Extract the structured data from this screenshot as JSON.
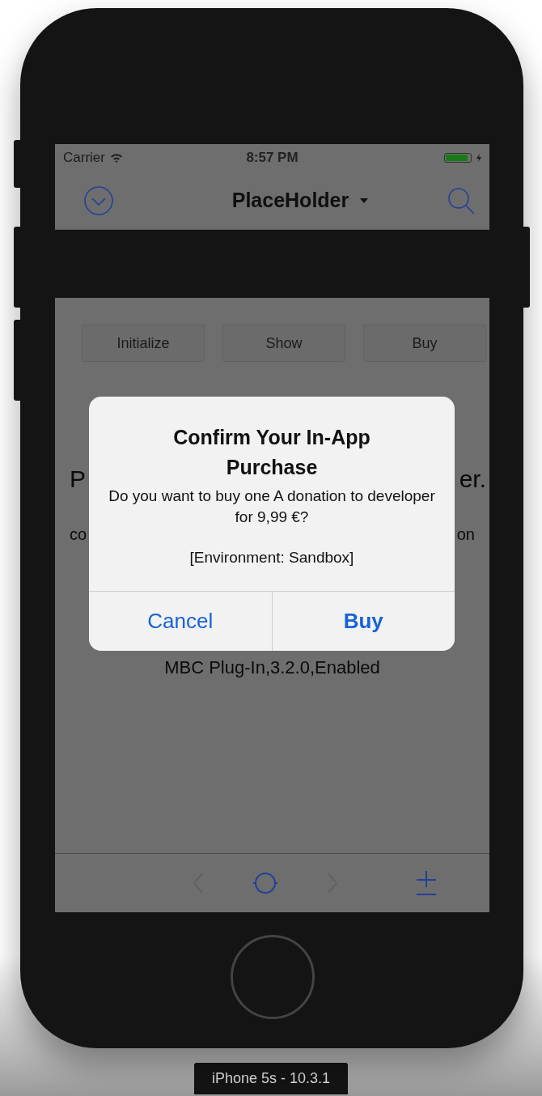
{
  "status_bar": {
    "carrier": "Carrier",
    "time": "8:57 PM",
    "charging": true,
    "level": 0.9
  },
  "nav_bar": {
    "title": "PlaceHolder"
  },
  "buttons": [
    {
      "label": "Initialize"
    },
    {
      "label": "Show"
    },
    {
      "label": "Buy"
    }
  ],
  "background_text": [
    {
      "left": "P",
      "right": "er."
    },
    {
      "left": "co",
      "right": "on"
    }
  ],
  "partly_hidden_line": "MBC Plug-In,3.2.0,Enabled",
  "alert": {
    "title": "Confirm Your In-App Purchase",
    "message": "Do you want to buy one A donation to developer for 9,99 €?",
    "environment": "[Environment: Sandbox]",
    "actions": [
      {
        "label": "Cancel",
        "kind": "cancel"
      },
      {
        "label": "Buy",
        "kind": "default"
      }
    ]
  },
  "device_label": "iPhone 5s - 10.3.1"
}
